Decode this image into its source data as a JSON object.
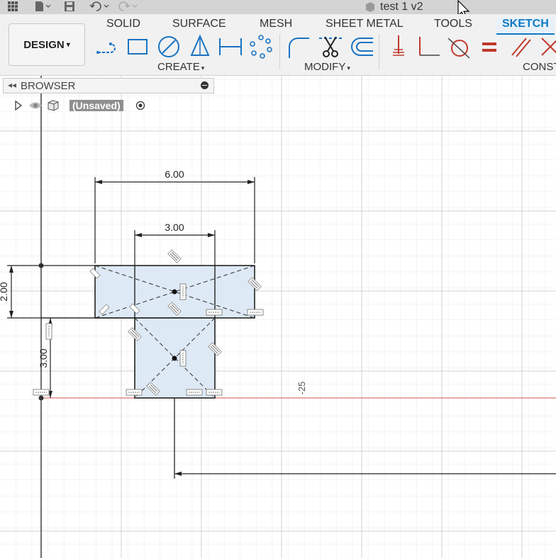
{
  "window": {
    "title": "test 1 v2"
  },
  "workspace": {
    "label": "DESIGN",
    "caret": "▾"
  },
  "tabs": [
    {
      "label": "SOLID"
    },
    {
      "label": "SURFACE"
    },
    {
      "label": "MESH"
    },
    {
      "label": "SHEET METAL"
    },
    {
      "label": "TOOLS"
    },
    {
      "label": "SKETCH",
      "active": true
    }
  ],
  "groups": {
    "create": "CREATE",
    "modify": "MODIFY",
    "constraints": "CONST"
  },
  "browser": {
    "label": "BROWSER",
    "collapse_glyph": "◂◂"
  },
  "tree": {
    "root_label": "(Unsaved)"
  },
  "sketch": {
    "dimensions": {
      "top_width": "6.00",
      "inner_width": "3.00",
      "top_height": "2.00",
      "stem_height": "3.00",
      "grid_label": "-25"
    }
  },
  "colors": {
    "accent": "#0d7ac4",
    "profile_fill": "#dde9f5",
    "axis_red": "#e07070",
    "constraint_red": "#c0392b"
  }
}
